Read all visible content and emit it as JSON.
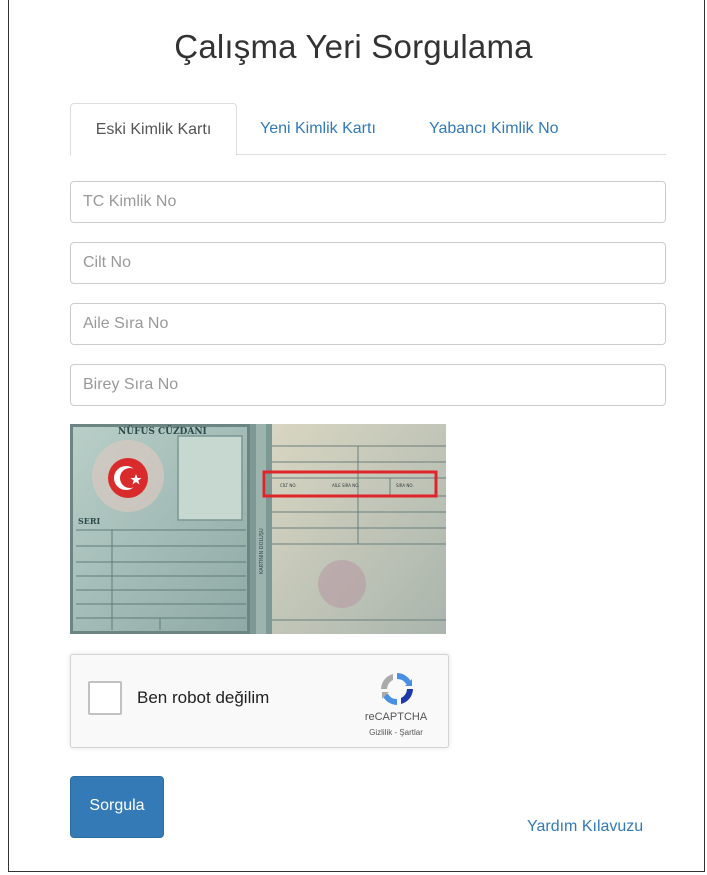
{
  "page": {
    "title": "Çalışma Yeri Sorgulama"
  },
  "tabs": [
    {
      "label": "Eski Kimlik Kartı",
      "active": true
    },
    {
      "label": "Yeni Kimlik Kartı",
      "active": false
    },
    {
      "label": "Yabancı Kimlik No",
      "active": false
    }
  ],
  "form": {
    "tc_placeholder": "TC Kimlik No",
    "cilt_placeholder": "Cilt No",
    "aile_placeholder": "Aile Sıra No",
    "birey_placeholder": "Birey Sıra No"
  },
  "id_card": {
    "header": "NÜFUS CÜZDANI",
    "seri_label": "SERI",
    "vertical_label": "KARTININ DOLUŞU",
    "highlight_fields": [
      "CİLT NO.",
      "AİLE SIRA NO.",
      "SIRA NO."
    ]
  },
  "captcha": {
    "label": "Ben robot değilim",
    "brand": "reCAPTCHA",
    "links": "Gizlilik - Şartlar"
  },
  "actions": {
    "submit_label": "Sorgula",
    "help_label": "Yardım Kılavuzu"
  },
  "colors": {
    "link": "#337ab7",
    "primary_button": "#337ab7",
    "highlight_box": "#e0252a"
  }
}
